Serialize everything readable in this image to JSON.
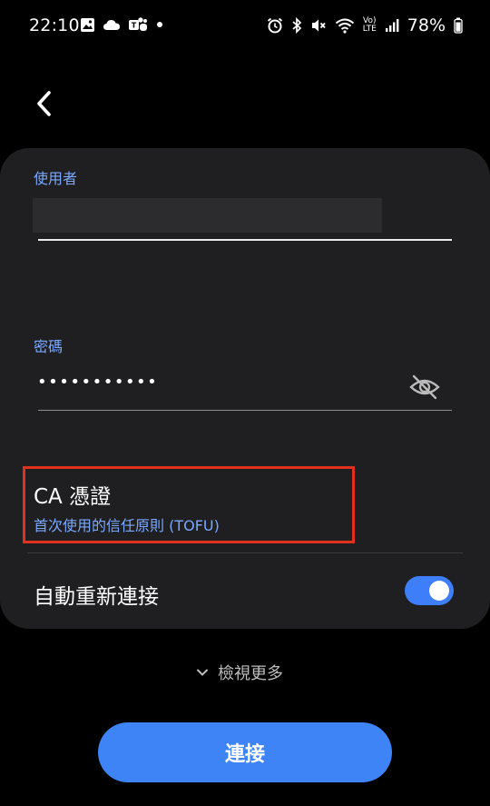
{
  "status_bar": {
    "time": "22:10",
    "battery": "78%",
    "volte": "Vo)",
    "lte": "LTE",
    "icons_left": [
      "gallery-icon",
      "cloud-icon",
      "teams-icon",
      "dot-icon"
    ],
    "icons_right": [
      "alarm-icon",
      "bluetooth-icon",
      "mute-icon",
      "wifi-icon",
      "volte-icon",
      "signal-icon",
      "battery-icon"
    ]
  },
  "form": {
    "username_label": "使用者",
    "username_value": "",
    "password_label": "密碼",
    "password_value": "•••••••••••",
    "ca_title": "CA 憑證",
    "ca_subtitle": "首次使用的信任原則 (TOFU)",
    "auto_reconnect_label": "自動重新連接",
    "auto_reconnect_on": true
  },
  "view_more_label": "檢視更多",
  "connect_label": "連接",
  "colors": {
    "accent_blue": "#3e84f7",
    "label_blue": "#7aa8ff",
    "highlight_red": "#e0301e",
    "card_bg": "#1f1f21"
  }
}
